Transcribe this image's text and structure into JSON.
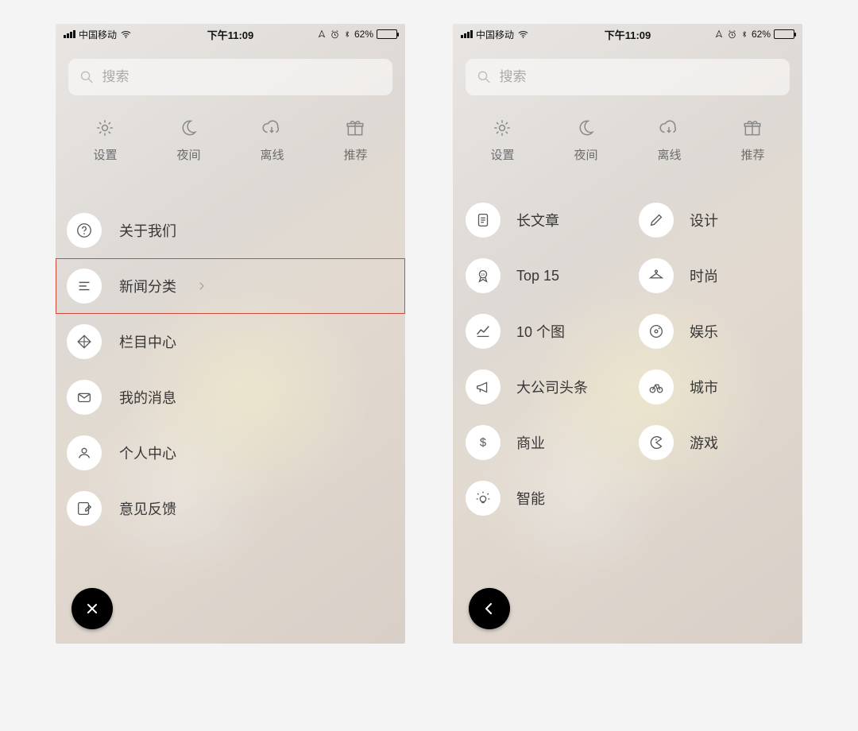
{
  "status": {
    "carrier": "中国移动",
    "time": "下午11:09",
    "battery_pct": "62%"
  },
  "search": {
    "placeholder": "搜索"
  },
  "actions": [
    {
      "id": "settings",
      "label": "设置",
      "icon": "gear"
    },
    {
      "id": "night",
      "label": "夜间",
      "icon": "moon"
    },
    {
      "id": "offline",
      "label": "离线",
      "icon": "cloud-down"
    },
    {
      "id": "recommend",
      "label": "推荐",
      "icon": "gift"
    }
  ],
  "menu": [
    {
      "id": "about",
      "label": "关于我们",
      "icon": "question"
    },
    {
      "id": "news-cat",
      "label": "新闻分类",
      "icon": "list",
      "chevron": true,
      "highlighted": true
    },
    {
      "id": "columns",
      "label": "栏目中心",
      "icon": "diamond"
    },
    {
      "id": "messages",
      "label": "我的消息",
      "icon": "mail"
    },
    {
      "id": "profile",
      "label": "个人中心",
      "icon": "person"
    },
    {
      "id": "feedback",
      "label": "意见反馈",
      "icon": "edit"
    }
  ],
  "categories": [
    {
      "id": "long",
      "label": "长文章",
      "icon": "doc"
    },
    {
      "id": "design",
      "label": "设计",
      "icon": "pencil"
    },
    {
      "id": "top15",
      "label": "Top 15",
      "icon": "badge"
    },
    {
      "id": "fashion",
      "label": "时尚",
      "icon": "hanger"
    },
    {
      "id": "tenpics",
      "label": "10 个图",
      "icon": "chart"
    },
    {
      "id": "ent",
      "label": "娱乐",
      "icon": "disc"
    },
    {
      "id": "bignews",
      "label": "大公司头条",
      "icon": "mega"
    },
    {
      "id": "city",
      "label": "城市",
      "icon": "bike"
    },
    {
      "id": "biz",
      "label": "商业",
      "icon": "dollar"
    },
    {
      "id": "game",
      "label": "游戏",
      "icon": "pac"
    },
    {
      "id": "smart",
      "label": "智能",
      "icon": "bulb"
    }
  ],
  "fab": {
    "left": "close",
    "right": "back"
  }
}
